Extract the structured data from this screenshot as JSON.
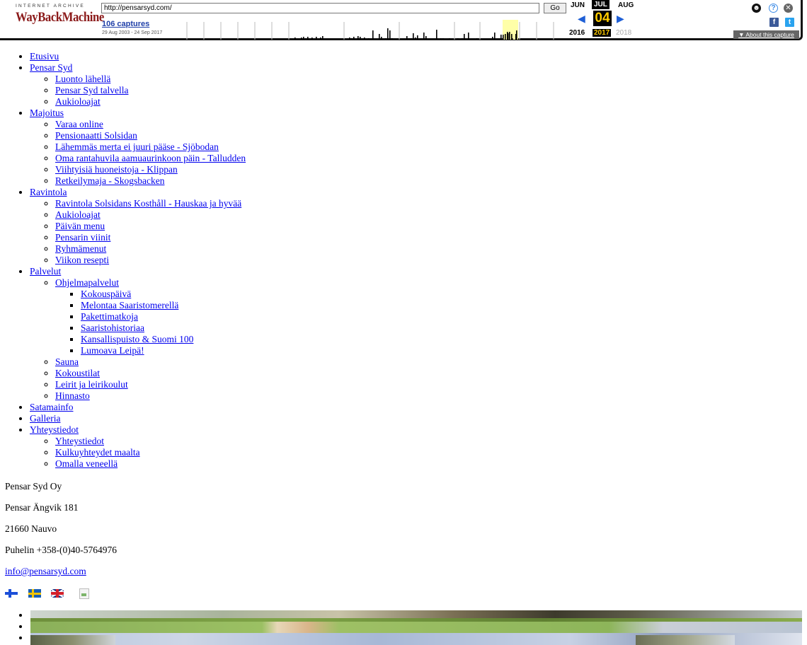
{
  "wayback": {
    "logo_top": "INTERNET ARCHIVE",
    "logo_main": "WayBackMachine",
    "url": "http://pensarsyd.com/",
    "go_label": "Go",
    "captures_label": "106 captures",
    "date_range": "29 Aug 2003 - 24 Sep 2017",
    "months": {
      "prev": "JUN",
      "current": "JUL",
      "next": "AUG"
    },
    "day": "04",
    "years": {
      "prev": "2016",
      "current": "2017",
      "next": "2018"
    },
    "about_label": "▼ About this capture",
    "icons": [
      "user-icon",
      "help-icon",
      "close-icon",
      "facebook-icon",
      "twitter-icon"
    ]
  },
  "nav": {
    "items": [
      {
        "label": "Etusivu",
        "children": []
      },
      {
        "label": "Pensar Syd",
        "children": [
          {
            "label": "Luonto lähellä"
          },
          {
            "label": "Pensar Syd talvella"
          },
          {
            "label": "Aukioloajat"
          }
        ]
      },
      {
        "label": "Majoitus",
        "children": [
          {
            "label": "Varaa online"
          },
          {
            "label": "Pensionaatti Solsidan"
          },
          {
            "label": "Lähemmäs merta ei juuri pääse - Sjöbodan"
          },
          {
            "label": "Oma rantahuvila aamuaurinkoon päin - Talludden"
          },
          {
            "label": "Viihtyisiä huoneistoja - Klippan"
          },
          {
            "label": "Retkeilymaja - Skogsbacken"
          }
        ]
      },
      {
        "label": "Ravintola",
        "children": [
          {
            "label": "Ravintola Solsidans Kosthåll - Hauskaa ja hyvää"
          },
          {
            "label": "Aukioloajat"
          },
          {
            "label": "Päivän menu"
          },
          {
            "label": "Pensarin viinit"
          },
          {
            "label": "Ryhmämenut"
          },
          {
            "label": "Viikon resepti"
          }
        ]
      },
      {
        "label": "Palvelut",
        "children": [
          {
            "label": "Ohjelmapalvelut",
            "children": [
              {
                "label": "Kokouspäivä"
              },
              {
                "label": "Melontaa Saaristomerellä"
              },
              {
                "label": "Pakettimatkoja"
              },
              {
                "label": "Saaristohistoriaa"
              },
              {
                "label": "Kansallispuisto & Suomi 100"
              },
              {
                "label": "Lumoava Leipä!"
              }
            ]
          },
          {
            "label": "Sauna"
          },
          {
            "label": "Kokoustilat"
          },
          {
            "label": "Leirit ja leirikoulut"
          },
          {
            "label": "Hinnasto"
          }
        ]
      },
      {
        "label": "Satamainfo",
        "children": []
      },
      {
        "label": "Galleria",
        "children": []
      },
      {
        "label": "Yhteystiedot",
        "children": [
          {
            "label": "Yhteystiedot"
          },
          {
            "label": "Kulkuyhteydet maalta"
          },
          {
            "label": "Omalla veneellä"
          }
        ]
      }
    ]
  },
  "contact": {
    "company": "Pensar Syd Oy",
    "street": "Pensar Ängvik 181",
    "postal": "21660 Nauvo",
    "phone": "Puhelin +358-(0)40-5764976",
    "email": "info@pensarsyd.com"
  },
  "flags": [
    "finnish-flag-icon",
    "swedish-flag-icon",
    "english-flag-icon",
    "broken-image-icon"
  ]
}
